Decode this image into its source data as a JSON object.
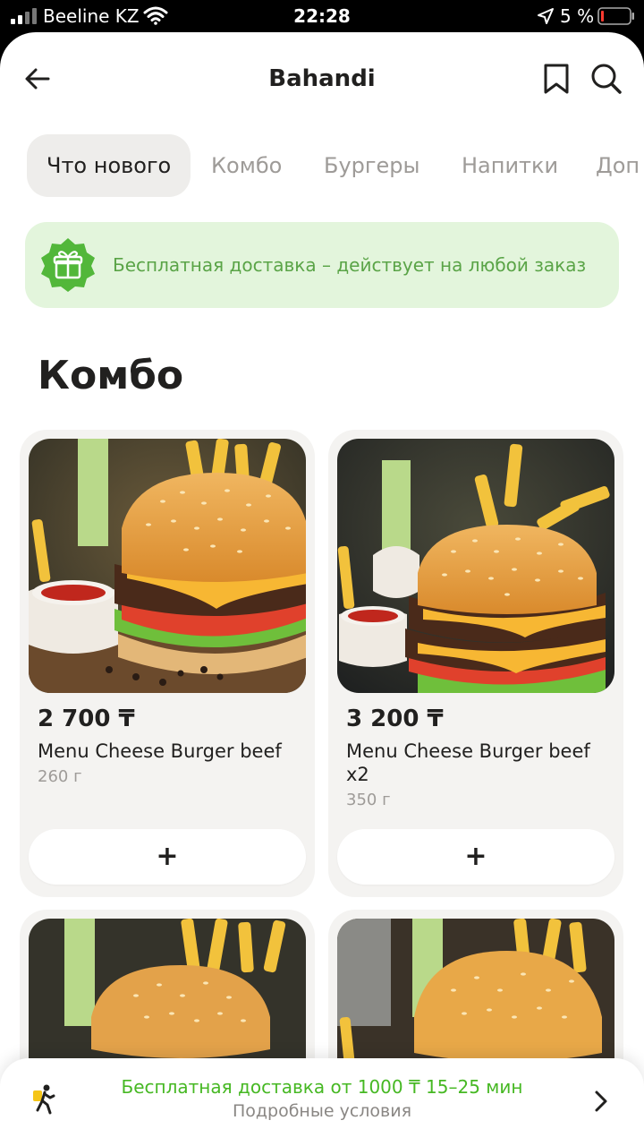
{
  "status_bar": {
    "carrier": "Beeline KZ",
    "time": "22:28",
    "battery": "5 %"
  },
  "header": {
    "title": "Bahandi"
  },
  "tabs": [
    {
      "label": "Что нового",
      "active": true
    },
    {
      "label": "Комбо",
      "active": false
    },
    {
      "label": "Бургеры",
      "active": false
    },
    {
      "label": "Напитки",
      "active": false
    },
    {
      "label": "Доп",
      "active": false
    }
  ],
  "promo": {
    "text": "Бесплатная доставка – действует на любой заказ",
    "icon": "gift-icon"
  },
  "section": {
    "title": "Комбо"
  },
  "products": [
    {
      "price": "2 700 ₸",
      "name": "Menu Cheese Burger beef",
      "weight": "260 г",
      "add_label": "+"
    },
    {
      "price": "3 200 ₸",
      "name": "Menu Cheese Burger beef x2",
      "weight": "350 г",
      "add_label": "+"
    }
  ],
  "delivery_bar": {
    "line1": "Бесплатная доставка от 1000 ₸ 15–25 мин",
    "line2": "Подробные условия"
  },
  "colors": {
    "accent_green": "#46b823",
    "promo_bg": "#e3f5dc",
    "card_bg": "#f4f3f1"
  }
}
